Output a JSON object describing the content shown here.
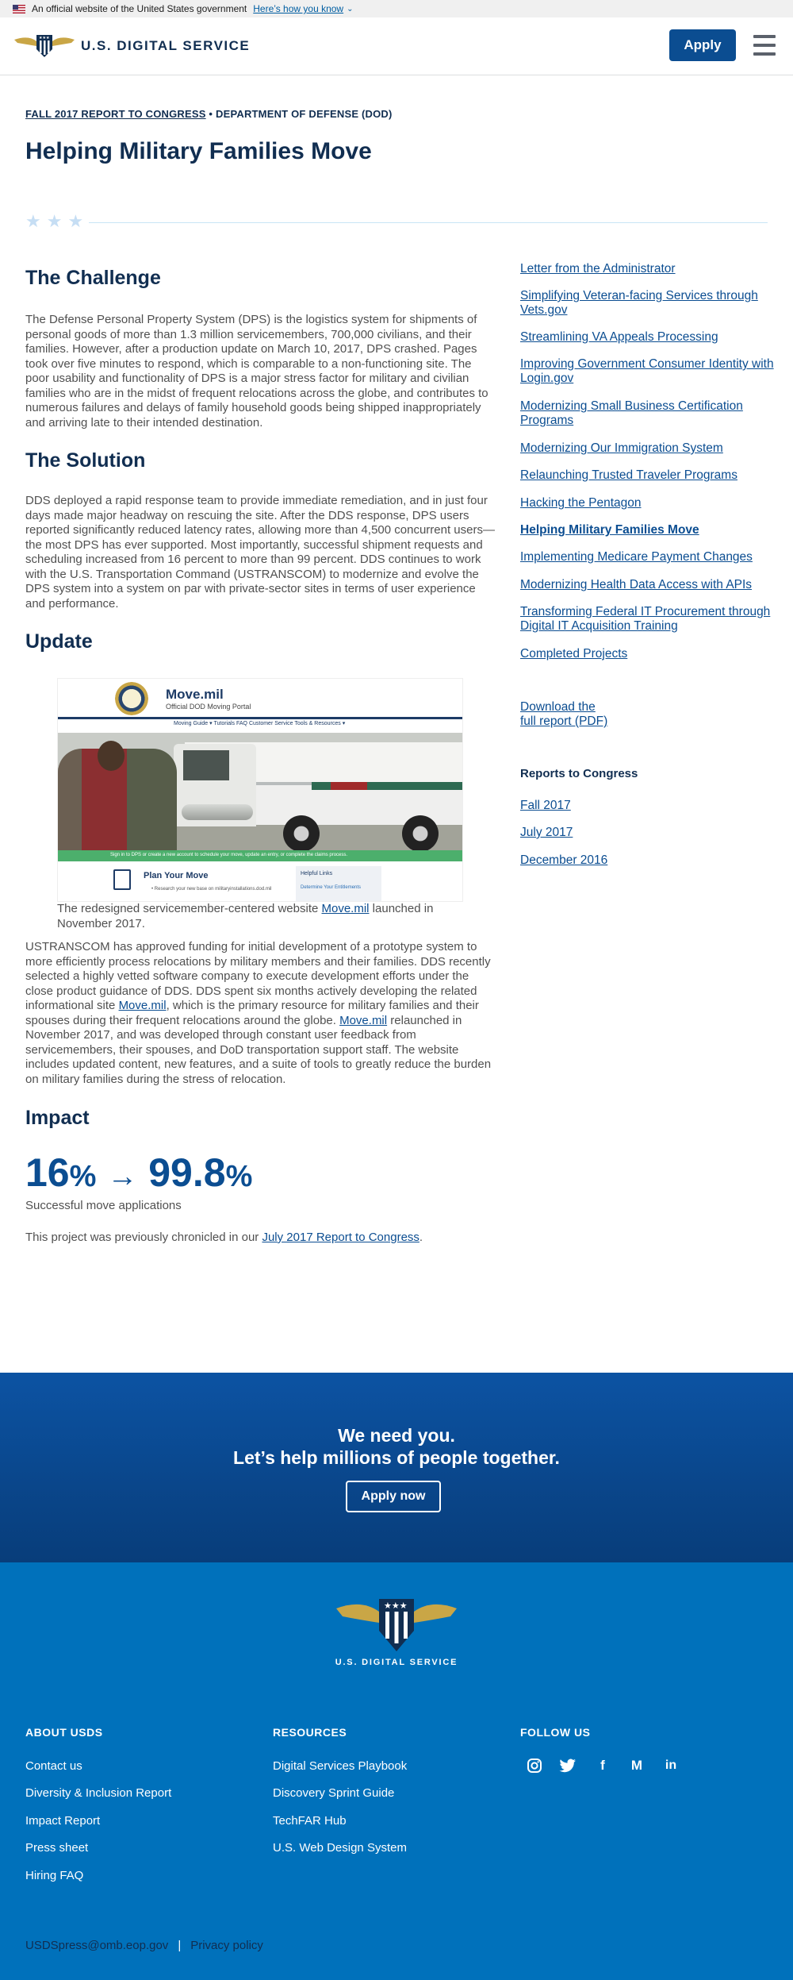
{
  "gov_banner": {
    "text": "An official website of the United States government",
    "link": "Here’s how you know"
  },
  "header": {
    "logo_text": "U.S. DIGITAL SERVICE",
    "apply_label": "Apply"
  },
  "breadcrumb": {
    "report_link": "FALL 2017 REPORT TO CONGRESS",
    "separator": " • ",
    "department": "DEPARTMENT OF DEFENSE (DOD)"
  },
  "page_title": "Helping Military Families Move",
  "sections": {
    "challenge": {
      "heading": "The Challenge",
      "body": "The Defense Personal Property System (DPS) is the logistics system for shipments of personal goods of more than 1.3 million servicemembers, 700,000 civilians, and their families. However, after a production update on March 10, 2017, DPS crashed. Pages took over five minutes to respond, which is comparable to a non-functioning site. The poor usability and functionality of DPS is a major stress factor for military and civilian families who are in the midst of frequent relocations across the globe, and contributes to numerous failures and delays of family household goods being shipped inappropriately and arriving late to their intended destination."
    },
    "solution": {
      "heading": "The Solution",
      "body": "DDS deployed a rapid response team to provide immediate remediation, and in just four days made major headway on rescuing the site. After the DDS response, DPS users reported significantly reduced latency rates, allowing more than 4,500 concurrent users—the most DPS has ever supported. Most importantly, successful shipment requests and scheduling increased from 16 percent to more than 99 percent. DDS continues to work with the U.S. Transportation Command (USTRANSCOM) to modernize and evolve the DPS system into a system on par with private-sector sites in terms of user experience and performance."
    },
    "update": {
      "heading": "Update",
      "caption_before": "The redesigned servicemember-centered website ",
      "caption_link": "Move.mil",
      "caption_after": " launched in November 2017.",
      "body_1": "USTRANSCOM has approved funding for initial development of a prototype system to more efficiently process relocations by military members and their families. DDS recently selected a highly vetted software company to execute development efforts under the close product guidance of DDS. DDS spent six months actively developing the related informational site ",
      "body_link_1": "Move.mil",
      "body_2": ", which is the primary resource for military families and their spouses during their frequent relocations around the globe. ",
      "body_link_2": "Move.mil",
      "body_3": " relaunched in November 2017, and was developed through constant user feedback from servicemembers, their spouses, and DoD transportation support staff. The website includes updated content, new features, and a suite of tools to greatly reduce the burden on military families during the stress of relocation."
    },
    "impact": {
      "heading": "Impact",
      "from_value": "16",
      "to_value": "99.8",
      "unit": "%",
      "arrow": "→",
      "label": "Successful move applications",
      "note_before": "This project was previously chronicled in our ",
      "note_link": "July 2017 Report to Congress",
      "note_after": "."
    }
  },
  "screenshot": {
    "site_title": "Move.mil",
    "site_subtitle": "Official DOD Moving Portal",
    "nav_text": "Moving Guide ▾    Tutorials    FAQ    Customer Service    Tools & Resources ▾",
    "green_bar": "Sign in to DPS or create a new account to schedule your move, update an entry, or complete the claims process.",
    "plan_title": "Plan Your Move",
    "plan_text": "• Research your new base on militaryinstallations.dod.mil",
    "helpful_title": "Helpful Links",
    "helpful_link": "Determine Your Entitlements"
  },
  "sidebar": {
    "links": [
      "Letter from the Administrator",
      "Simplifying Veteran-facing Services through Vets.gov",
      "Streamlining VA Appeals Processing",
      "Improving Government Consumer Identity with Login.gov",
      "Modernizing Small Business Certification Programs",
      "Modernizing Our Immigration System",
      "Relaunching Trusted Traveler Programs",
      "Hacking the Pentagon",
      "Helping Military Families Move",
      "Implementing Medicare Payment Changes",
      "Modernizing Health Data Access with APIs",
      "Transforming Federal IT Procurement through Digital IT Acquisition Training",
      "Completed Projects"
    ],
    "download_line1": "Download the",
    "download_line2": "full report (PDF)",
    "reports_heading": "Reports to Congress",
    "reports": [
      "Fall 2017",
      "July 2017",
      "December 2016"
    ]
  },
  "cta": {
    "line1": "We need you.",
    "line2": "Let’s help millions of people together.",
    "button": "Apply now"
  },
  "footer": {
    "logo_text": "U.S. DIGITAL SERVICE",
    "about_heading": "ABOUT USDS",
    "about_links": [
      "Contact us",
      "Diversity & Inclusion Report",
      "Impact Report",
      "Press sheet",
      "Hiring FAQ"
    ],
    "resources_heading": "RESOURCES",
    "resources_links": [
      "Digital Services Playbook",
      "Discovery Sprint Guide",
      "TechFAR Hub",
      "U.S. Web Design System"
    ],
    "follow_heading": "FOLLOW US",
    "social_icons": [
      "instagram-icon",
      "twitter-icon",
      "facebook-icon",
      "medium-icon",
      "linkedin-icon"
    ],
    "email": "USDSpress@omb.eop.gov",
    "separator": "|",
    "privacy": "Privacy policy"
  },
  "colors": {
    "navy": "#112e51",
    "primary": "#0b4d91",
    "footer_blue": "#0071bb",
    "gold": "#c9a646"
  }
}
